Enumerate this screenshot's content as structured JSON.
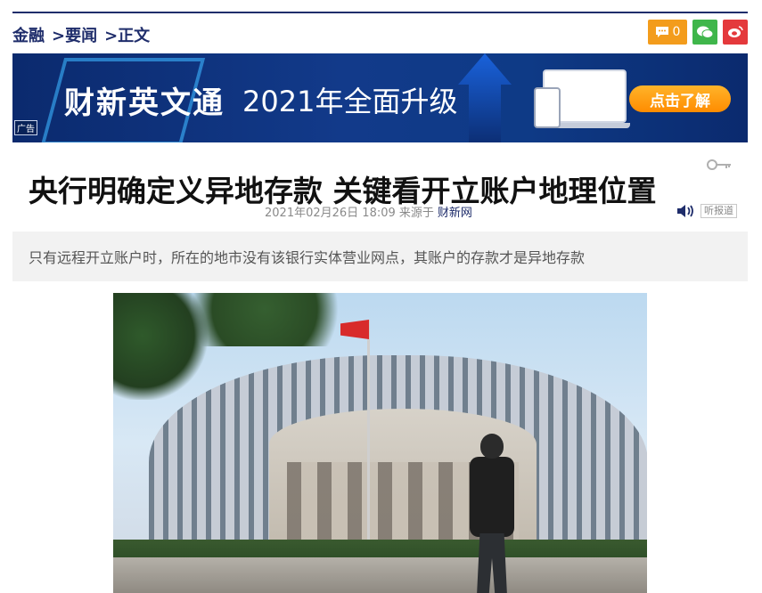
{
  "breadcrumb": {
    "items": [
      "金融",
      ">要闻",
      ">正文"
    ]
  },
  "share": {
    "comment_count": "0",
    "icons": [
      "comment-icon",
      "wechat-icon",
      "weibo-icon"
    ],
    "colors": {
      "comment": "#f39c1c",
      "wechat": "#3fb64b",
      "weibo": "#e4393c"
    }
  },
  "banner": {
    "brand": "财新英文通",
    "slogan": "2021年全面升级",
    "cta": "点击了解",
    "ad_tag": "广告"
  },
  "article": {
    "title": "央行明确定义异地存款 关键看开立账户地理位置",
    "date": "2021年02月26日 18:09",
    "source_prefix": "来源于",
    "source": "财新网",
    "listen_label": "听报道",
    "summary": "只有远程开立账户时，所在的地市没有该银行实体营业网点，其账户的存款才是异地存款"
  },
  "theme": {
    "primary": "#1f2d6b"
  }
}
